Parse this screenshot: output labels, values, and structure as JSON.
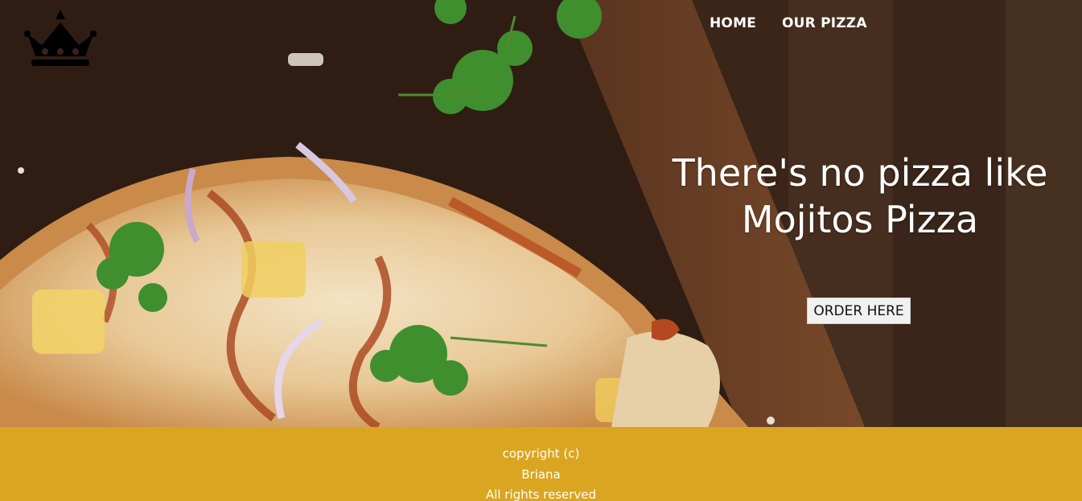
{
  "nav": {
    "items": [
      {
        "label": "HOME"
      },
      {
        "label": "OUR PIZZA"
      }
    ]
  },
  "logo": {
    "icon": "crown-icon"
  },
  "hero": {
    "headline_line1": "There's no pizza like",
    "headline_line2": "Mojitos Pizza",
    "order_button": "ORDER HERE"
  },
  "footer": {
    "line1": "copyright (c)",
    "line2": "Briana",
    "line3": "All rights reserved"
  },
  "colors": {
    "footer_bg": "#daa520",
    "nav_text": "#ffffff",
    "headline_text": "#ffffff",
    "button_bg": "#f1f1f1"
  }
}
